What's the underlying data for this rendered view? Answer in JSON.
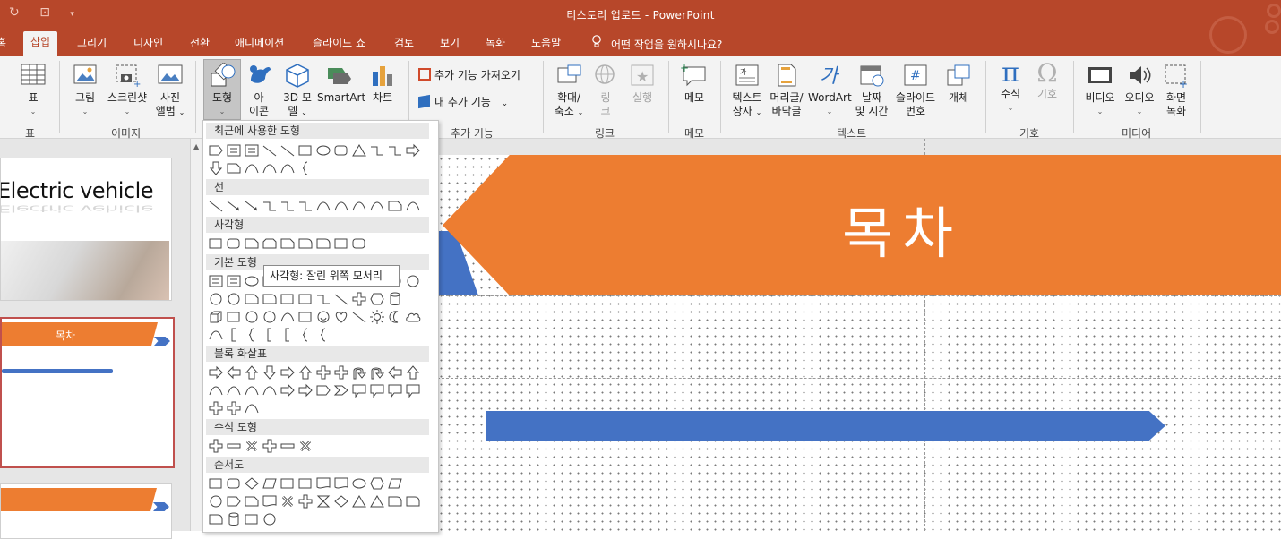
{
  "window": {
    "title": "티스토리 업로드  -  PowerPoint"
  },
  "quick_access": {
    "redo_icon": "redo-icon",
    "present_icon": "present-from-start-icon",
    "customize_icon": "customize-qat-icon"
  },
  "tabs": [
    "홈",
    "삽입",
    "그리기",
    "디자인",
    "전환",
    "애니메이션",
    "슬라이드 쇼",
    "검토",
    "보기",
    "녹화",
    "도움말"
  ],
  "active_tab": "삽입",
  "tell_me": "어떤 작업을 원하시나요?",
  "ribbon": {
    "table": {
      "label": "표"
    },
    "images": {
      "picture": "그림",
      "screenshot": "스크린샷",
      "album1": "사진",
      "album2": "앨범"
    },
    "illustrations": {
      "shapes": "도형",
      "icons1": "아",
      "icons2": "이콘",
      "models1": "3D 모",
      "models2": "델",
      "smartart": "SmartArt",
      "chart": "차트"
    },
    "addins": {
      "get": "추가 기능 가져오기",
      "my": "내 추가 기능"
    },
    "links": {
      "zoom1": "확대/",
      "zoom2": "축소",
      "link1": "링",
      "link2": "크",
      "action": "실행"
    },
    "comments": {
      "comment": "메모"
    },
    "text": {
      "textbox1": "텍스트",
      "textbox2": "상자",
      "header1": "머리글/",
      "header2": "바닥글",
      "wordart": "WordArt",
      "date1": "날짜",
      "date2": "및 시간",
      "slidenum1": "슬라이드",
      "slidenum2": "번호",
      "object": "개체"
    },
    "symbols": {
      "equation": "수식",
      "symbol": "기호"
    },
    "media": {
      "video": "비디오",
      "audio": "오디오",
      "rec1": "화면",
      "rec2": "녹화"
    },
    "groups": {
      "table": "표",
      "images": "이미지",
      "addins": "추가 기능",
      "links": "링크",
      "comments": "메모",
      "text": "텍스트",
      "symbols": "기호",
      "media": "미디어"
    }
  },
  "slides_panel": {
    "slide1_title": "Electric vehicle",
    "slide2_header": "목차"
  },
  "shapes_gallery": {
    "sections": [
      "최근에 사용한 도형",
      "선",
      "사각형",
      "기본 도형",
      "블록 화살표",
      "수식 도형",
      "순서도"
    ],
    "tooltip": "사각형: 잘린 위쪽 모서리"
  },
  "slide": {
    "title": "목차"
  },
  "colors": {
    "accent_title": "#b7472a",
    "orange": "#ed7d31",
    "blue": "#4472c4",
    "ribbon_bg": "#f3f3f3"
  }
}
